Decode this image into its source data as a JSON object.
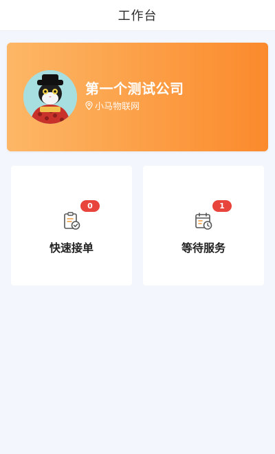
{
  "header": {
    "title": "工作台"
  },
  "company": {
    "name": "第一个测试公司",
    "location": "小马物联网",
    "avatar": "cat-avatar",
    "location_icon": "location-pin-icon"
  },
  "tiles": [
    {
      "label": "快速接单",
      "badge": "0",
      "icon": "clipboard-check-icon"
    },
    {
      "label": "等待服务",
      "badge": "1",
      "icon": "calendar-clock-icon"
    }
  ],
  "colors": {
    "card_gradient_start": "#fdb766",
    "card_gradient_end": "#fb8a2c",
    "badge": "#e8453c",
    "background": "#f3f6fc",
    "icon_gray": "#555555",
    "icon_accent": "#f39a3a"
  }
}
